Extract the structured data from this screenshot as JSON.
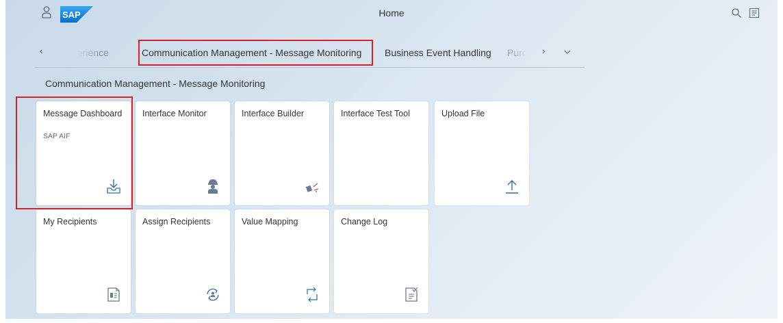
{
  "shell": {
    "title": "Home",
    "logo_text": "SAP",
    "icons": [
      "user-icon",
      "search-icon",
      "notifications-icon"
    ]
  },
  "tabs": {
    "items": [
      {
        "label": "erience",
        "state": "clipped-left"
      },
      {
        "label": "Communication Management - Message Monitoring",
        "state": "selected"
      },
      {
        "label": "Business Event Handling",
        "state": "normal"
      },
      {
        "label": "Purc",
        "state": "clipped-right"
      }
    ],
    "icons": [
      "chevron-left-icon",
      "chevron-right-icon",
      "chevron-down-icon"
    ]
  },
  "group": {
    "title": "Communication Management - Message Monitoring"
  },
  "tiles": [
    {
      "title": "Message Dashboard",
      "subtitle": "SAP AIF",
      "icon": "download-tray-icon"
    },
    {
      "title": "Interface Monitor",
      "subtitle": "",
      "icon": "worker-icon"
    },
    {
      "title": "Interface Builder",
      "subtitle": "",
      "icon": "tools-icon"
    },
    {
      "title": "Interface Test Tool",
      "subtitle": "",
      "icon": ""
    },
    {
      "title": "Upload File",
      "subtitle": "",
      "icon": "upload-icon"
    },
    {
      "title": "My Recipients",
      "subtitle": "",
      "icon": "contact-list-icon"
    },
    {
      "title": "Assign Recipients",
      "subtitle": "",
      "icon": "user-sync-icon"
    },
    {
      "title": "Value Mapping",
      "subtitle": "",
      "icon": "mapping-arrows-icon"
    },
    {
      "title": "Change Log",
      "subtitle": "",
      "icon": "document-edit-icon"
    }
  ],
  "colors": {
    "highlight": "#d7212b",
    "sap_blue": "#1a7fd0",
    "icon_blue": "#2f6fa6",
    "text": "#32363a"
  }
}
